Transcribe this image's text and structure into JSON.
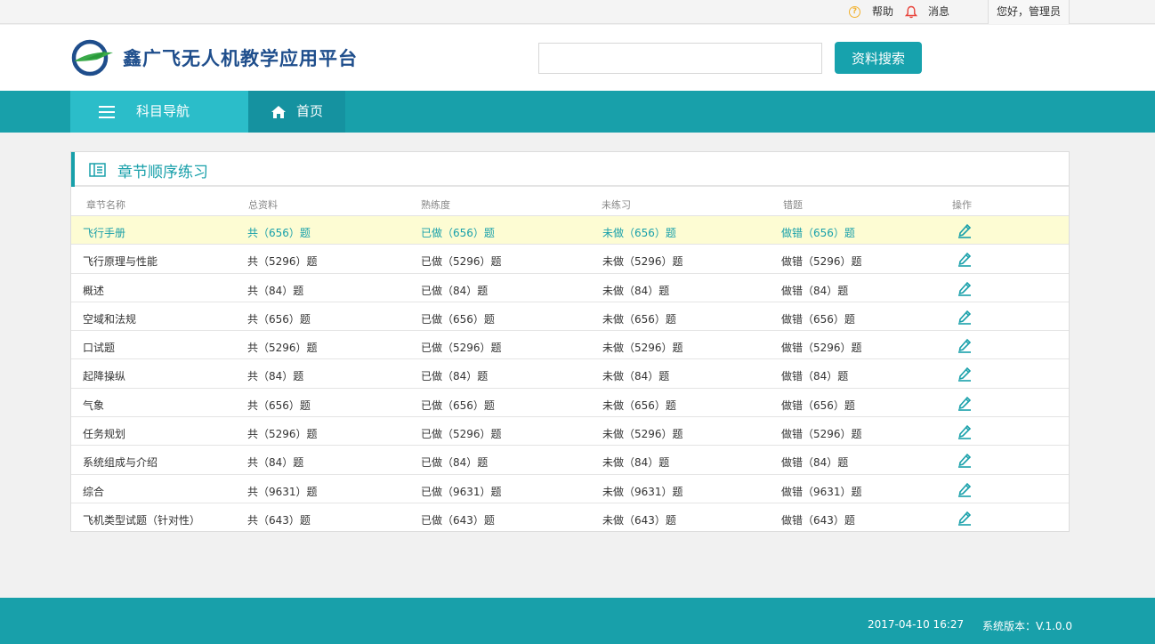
{
  "topbar": {
    "help": "帮助",
    "messages": "消息",
    "greeting": "您好，管理员"
  },
  "header": {
    "brand": "鑫广飞无人机教学应用平台",
    "search_placeholder": "",
    "search_button": "资料搜索"
  },
  "nav": {
    "subject_nav": "科目导航",
    "home": "首页"
  },
  "panel": {
    "title": "章节顺序练习",
    "columns": [
      "章节名称",
      "总资料",
      "熟练度",
      "未练习",
      "错题",
      "操作"
    ],
    "rows": [
      {
        "name": "飞行手册",
        "total": "共（656）题",
        "done": "已做（656）题",
        "undone": "未做（656）题",
        "wrong": "做错（656）题"
      },
      {
        "name": "飞行原理与性能",
        "total": "共（5296）题",
        "done": "已做（5296）题",
        "undone": "未做（5296）题",
        "wrong": "做错（5296）题"
      },
      {
        "name": "概述",
        "total": "共（84）题",
        "done": "已做（84）题",
        "undone": "未做（84）题",
        "wrong": "做错（84）题"
      },
      {
        "name": "空域和法规",
        "total": "共（656）题",
        "done": "已做（656）题",
        "undone": "未做（656）题",
        "wrong": "做错（656）题"
      },
      {
        "name": "口试题",
        "total": "共（5296）题",
        "done": "已做（5296）题",
        "undone": "未做（5296）题",
        "wrong": "做错（5296）题"
      },
      {
        "name": "起降操纵",
        "total": "共（84）题",
        "done": "已做（84）题",
        "undone": "未做（84）题",
        "wrong": "做错（84）题"
      },
      {
        "name": "气象",
        "total": "共（656）题",
        "done": "已做（656）题",
        "undone": "未做（656）题",
        "wrong": "做错（656）题"
      },
      {
        "name": "任务规划",
        "total": "共（5296）题",
        "done": "已做（5296）题",
        "undone": "未做（5296）题",
        "wrong": "做错（5296）题"
      },
      {
        "name": "系统组成与介绍",
        "total": "共（84）题",
        "done": "已做（84）题",
        "undone": "未做（84）题",
        "wrong": "做错（84）题"
      },
      {
        "name": "综合",
        "total": "共（9631）题",
        "done": "已做（9631）题",
        "undone": "未做（9631）题",
        "wrong": "做错（9631）题"
      },
      {
        "name": "飞机类型试题（针对性）",
        "total": "共（643）题",
        "done": "已做（643）题",
        "undone": "未做（643）题",
        "wrong": "做错（643）题"
      }
    ]
  },
  "footer": {
    "datetime": "2017-04-10  16:27",
    "version": "系统版本：V.1.0.0"
  },
  "colors": {
    "accent": "#18a0aa",
    "active_row": "#fdfcd3",
    "brand_text": "#1f4e8c"
  },
  "icons": [
    "help-icon",
    "bell-icon",
    "logo-icon",
    "menu-icon",
    "home-icon",
    "list-icon",
    "edit-icon"
  ]
}
